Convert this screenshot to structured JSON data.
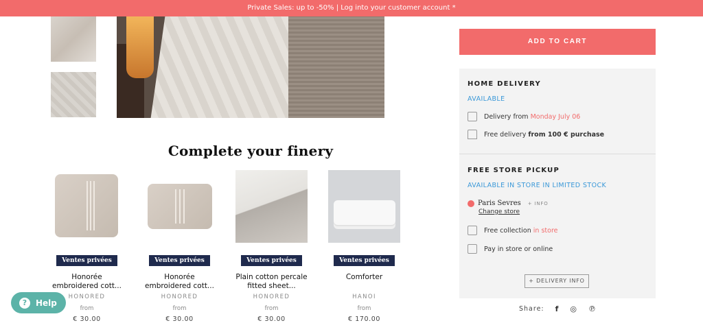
{
  "promo_bar": "Private Sales: up to -50% | Log into your customer account *",
  "section_title": "Complete your finery",
  "products": [
    {
      "badge": "Ventes privées",
      "name_line1": "Honorée",
      "name_line2": "embroidered cott...",
      "brand": "HONORED",
      "from": "from",
      "price": "€ 30.00"
    },
    {
      "badge": "Ventes privées",
      "name_line1": "Honorée",
      "name_line2": "embroidered cott...",
      "brand": "HONORED",
      "from": "from",
      "price": "€ 30.00"
    },
    {
      "badge": "Ventes privées",
      "name_line1": "Plain cotton percale",
      "name_line2": "fitted sheet...",
      "brand": "HONORED",
      "from": "from",
      "price": "€ 30.00"
    },
    {
      "badge": "Ventes privées",
      "name_line1": "Comforter",
      "name_line2": "",
      "brand": "HANOI",
      "from": "from",
      "price": "€ 170.00"
    }
  ],
  "cart": {
    "add_label": "ADD TO CART"
  },
  "home_delivery": {
    "title": "HOME DELIVERY",
    "status": "AVAILABLE",
    "delivery_prefix": "Delivery from",
    "delivery_date": "Monday July 06",
    "free_prefix": "Free delivery",
    "free_threshold": "from 100 € purchase"
  },
  "store_pickup": {
    "title": "FREE STORE PICKUP",
    "status": "AVAILABLE IN STORE IN LIMITED STOCK",
    "store_name": "Paris Sevres",
    "info_label": "+ INFO",
    "change_label": "Change store",
    "collection_prefix": "Free collection",
    "collection_suffix": "in store",
    "pay_label": "Pay in store or online",
    "delivery_info_label": "+ DELIVERY INFO"
  },
  "share": {
    "label": "Share:",
    "icons": [
      "facebook-icon",
      "instagram-icon",
      "pinterest-icon"
    ]
  },
  "help": {
    "label": "Help"
  },
  "colors": {
    "accent": "#f26b6b",
    "available": "#3a98d8",
    "badge": "#1f2a4d",
    "help": "#5cb3a8"
  }
}
